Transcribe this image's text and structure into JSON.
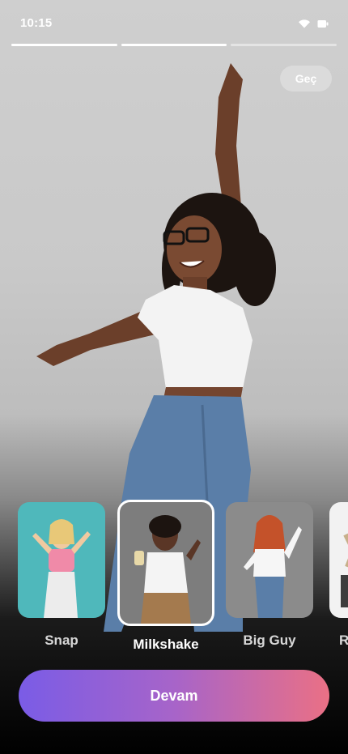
{
  "status_bar": {
    "time": "10:15",
    "icons": [
      "wifi-icon",
      "battery-icon"
    ]
  },
  "story_progress": [
    {
      "name": "segment-1",
      "fill_fraction": 1.0
    },
    {
      "name": "segment-2",
      "fill_fraction": 1.0
    },
    {
      "name": "segment-3",
      "fill_fraction": 0.0
    }
  ],
  "header": {
    "skip_label": "Geç"
  },
  "hero": {
    "description": "Dancing woman in white crop top and jeans"
  },
  "styles": {
    "selected_index": 1,
    "items": [
      {
        "label": "Snap",
        "thumb_bg": "#4fb8bb"
      },
      {
        "label": "Milkshake",
        "thumb_bg": "#7d7d7d"
      },
      {
        "label": "Big Guy",
        "thumb_bg": "#8b8b8b"
      },
      {
        "label": "R",
        "thumb_bg": "#f2f2f2"
      }
    ]
  },
  "footer": {
    "continue_label": "Devam"
  },
  "colors": {
    "gradient_start": "#7a5ce6",
    "gradient_end": "#ea7085"
  }
}
